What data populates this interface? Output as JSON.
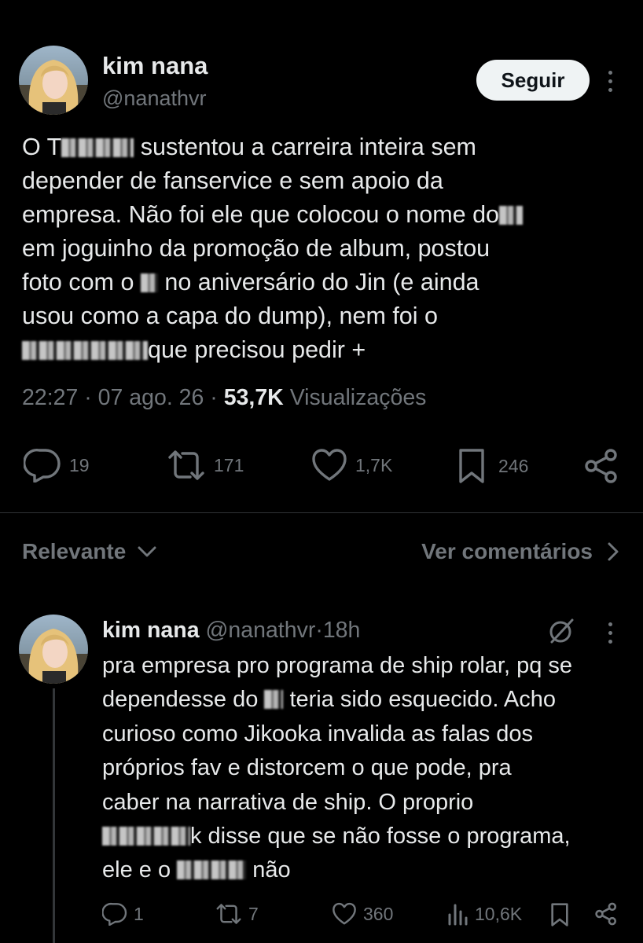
{
  "main_tweet": {
    "author_name": "kim nana",
    "author_handle": "@nanathvr",
    "follow_label": "Seguir",
    "text_part1": "O T",
    "text_part2": " sustentou a carreira inteira sem\ndepender de fanservice e sem apoio da\nempresa. Não foi ele que colocou o nome do",
    "text_part3": "\nem joguinho da promoção de album, postou\nfoto com o ",
    "text_part4": " no aniversário do Jin (e ainda\nusou como a capa do dump), nem foi o\n",
    "text_part5": "que precisou pedir +",
    "time": "22:27",
    "date": "07 ago. 26",
    "views_count": "53,7K",
    "views_label": "Visualizações",
    "replies": "19",
    "reposts": "171",
    "likes": "1,7K",
    "bookmarks": "246"
  },
  "sort": {
    "label": "Relevante",
    "view_comments": "Ver comentários"
  },
  "reply": {
    "author_name": "kim nana",
    "author_handle": "@nanathvr",
    "separator": "·",
    "age": "18h",
    "text_part1": "pra empresa pro programa de ship rolar, pq se\ndependesse do ",
    "text_part2": " teria sido esquecido. Acho\ncurioso como Jikooka invalida as falas dos\npróprios fav e distorcem o que pode, pra\ncaber na narrativa de ship. O proprio\n",
    "text_part3": "k disse que se não fosse o programa,\nele e o ",
    "text_part4": " não",
    "replies": "1",
    "reposts": "7",
    "likes": "360",
    "views": "10,6K"
  },
  "colors": {
    "background": "#000000",
    "text_primary": "#e7e9ea",
    "text_secondary": "#71767b",
    "divider": "#2f3336",
    "follow_bg": "#eff3f4"
  },
  "icons": [
    "reply-icon",
    "repost-icon",
    "like-icon",
    "bookmark-icon",
    "share-icon",
    "views-icon",
    "chevron-down-icon",
    "chevron-right-icon",
    "more-icon",
    "grok-icon"
  ]
}
